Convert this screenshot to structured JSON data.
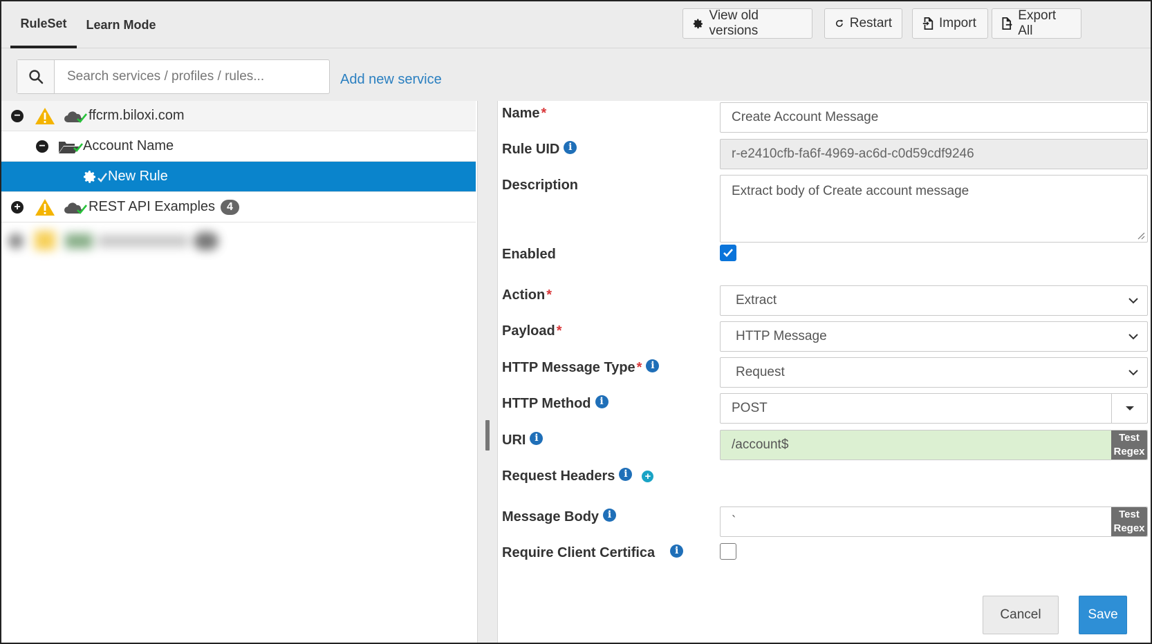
{
  "tabs": [
    {
      "label": "RuleSet",
      "active": true
    },
    {
      "label": "Learn Mode",
      "active": false
    }
  ],
  "toolbar": {
    "view_old_versions": "View old versions",
    "restart": "Restart",
    "import": "Import",
    "export_all": "Export All"
  },
  "search": {
    "placeholder": "Search services / profiles / rules...",
    "add_new_service": "Add new service"
  },
  "tree": {
    "items": [
      {
        "label": "ffcrm.biloxi.com",
        "level": 0,
        "toggle": "−"
      },
      {
        "label": "Account Name",
        "level": 1,
        "toggle": "−"
      },
      {
        "label": "New Rule",
        "level": 2,
        "selected": true
      },
      {
        "label": "REST API Examples",
        "level": 0,
        "toggle": "+",
        "badge": "4"
      }
    ]
  },
  "form": {
    "name": {
      "label": "Name",
      "value": "Create Account Message"
    },
    "rule_uid": {
      "label": "Rule UID",
      "value": "r-e2410cfb-fa6f-4969-ac6d-c0d59cdf9246"
    },
    "description": {
      "label": "Description",
      "value": "Extract body of Create account message"
    },
    "enabled": {
      "label": "Enabled",
      "checked": true
    },
    "action": {
      "label": "Action",
      "value": "Extract"
    },
    "payload": {
      "label": "Payload",
      "value": "HTTP Message"
    },
    "http_message_type": {
      "label": "HTTP Message Type",
      "value": "Request"
    },
    "http_method": {
      "label": "HTTP Method",
      "value": "POST"
    },
    "uri": {
      "label": "URI",
      "value": "/account$"
    },
    "request_headers": {
      "label": "Request Headers"
    },
    "message_body": {
      "label": "Message Body",
      "value": "`"
    },
    "require_client_cert": {
      "label": "Require Client Certifica",
      "checked": false
    },
    "test_regex_line1": "Test",
    "test_regex_line2": "Regex",
    "required_mark": "*",
    "info_glyph": "i"
  },
  "footer": {
    "cancel": "Cancel",
    "save": "Save"
  },
  "colors": {
    "accent": "#0a84cc",
    "link": "#2a7fc0",
    "save": "#2e8fd6",
    "required": "#d9383a",
    "warning": "#f4b400",
    "cloud_check": "#27c23a",
    "uri_valid_bg": "#dcf0d2"
  }
}
